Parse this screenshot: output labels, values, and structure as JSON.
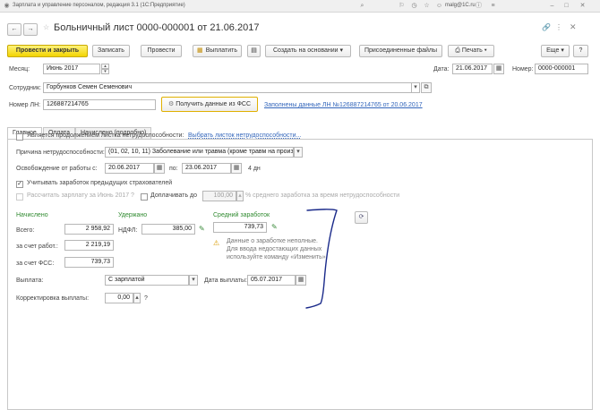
{
  "titlebar": {
    "app_title": "Зарплата и управление персоналом, редакция 3.1 (1С:Предприятие)",
    "user": "malg@1C.ru"
  },
  "header": {
    "doc_title": "Больничный лист 0000-000001 от 21.06.2017"
  },
  "toolbar": {
    "post_close": "Провести и закрыть",
    "save": "Записать",
    "post": "Провести",
    "pay": "Выплатить",
    "create_based": "Создать на основании",
    "attached_files": "Присоединенные файлы",
    "print": "Печать",
    "more": "Еще",
    "help": "?"
  },
  "form": {
    "month_label": "Месяц:",
    "month_value": "Июнь 2017",
    "date_label": "Дата:",
    "date_value": "21.06.2017",
    "number_label": "Номер:",
    "number_value": "0000-000001",
    "employee_label": "Сотрудник:",
    "employee_value": "Горбунков Семен Семенович",
    "sick_number_label": "Номер ЛН:",
    "sick_number_value": "126887214765",
    "fss_button": "Получить данные из ФСС",
    "filled_link": "Заполнены данные ЛН №126887214765 от 20.06.2017"
  },
  "tabs": [
    "Главное",
    "Оплата",
    "Начислено (подробно)"
  ],
  "main": {
    "continuation_label": "Является продолжением листка нетрудоспособности:",
    "choose_link": "Выбрать листок нетрудоспособности...",
    "reason_label": "Причина нетрудоспособности:",
    "reason_value": "(01, 02, 10, 11) Заболевание или травма (кроме травм на произ",
    "release_label": "Освобождение от работы с:",
    "release_from": "20.06.2017",
    "to_label": "по:",
    "release_to": "23.06.2017",
    "days": "4 дн",
    "prev_insurers_label": "Учитывать заработок предыдущих страхователей",
    "calc_salary_label": "Рассчитать зарплату за Июнь 2017",
    "calc_salary_q": "?",
    "pay_up_to_label": "Доплачивать до",
    "pay_up_to_value": "100,00",
    "pay_up_to_suffix": "% среднего заработка за время нетрудоспособности"
  },
  "amounts": {
    "accrued_header": "Начислено",
    "withheld_header": "Удержано",
    "avg_header": "Средний заработок",
    "total_label": "Всего:",
    "total_value": "2 958,92",
    "employer_label": "за счет работ.:",
    "employer_value": "2 219,19",
    "fss_label": "за счет ФСС:",
    "fss_value": "739,73",
    "ndfl_label": "НДФЛ:",
    "ndfl_value": "385,00",
    "avg_value": "739,73",
    "warning_text": [
      "Данные о заработке неполные.",
      "Для ввода недостающих данных",
      "используйте команду «Изменить»"
    ]
  },
  "payment": {
    "payout_label": "Выплата:",
    "payout_value": "С зарплатой",
    "pay_date_label": "Дата выплаты:",
    "pay_date_value": "05.07.2017",
    "correction_label": "Корректировка выплаты:",
    "correction_value": "0,00",
    "correction_q": "?"
  },
  "colors": {
    "accent_yellow": "#f2d400",
    "link_blue": "#3366bb",
    "label_green": "#2f8a2f",
    "annotation": "#1a2a8a"
  }
}
